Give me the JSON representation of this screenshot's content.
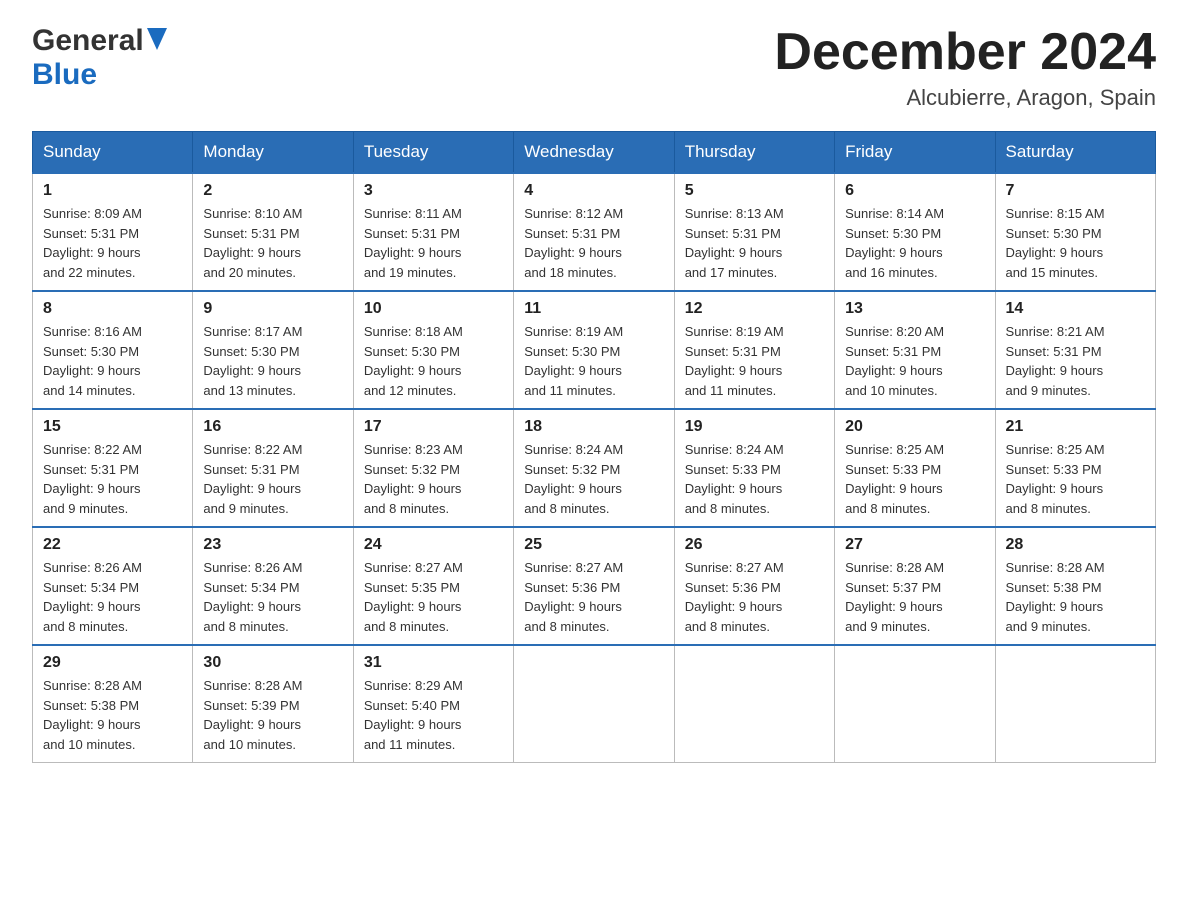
{
  "header": {
    "logo": {
      "general": "General",
      "blue": "Blue",
      "triangle_alt": "triangle"
    },
    "month_title": "December 2024",
    "location": "Alcubierre, Aragon, Spain"
  },
  "calendar": {
    "days_of_week": [
      "Sunday",
      "Monday",
      "Tuesday",
      "Wednesday",
      "Thursday",
      "Friday",
      "Saturday"
    ],
    "weeks": [
      [
        {
          "day": "1",
          "sunrise": "Sunrise: 8:09 AM",
          "sunset": "Sunset: 5:31 PM",
          "daylight": "Daylight: 9 hours and 22 minutes."
        },
        {
          "day": "2",
          "sunrise": "Sunrise: 8:10 AM",
          "sunset": "Sunset: 5:31 PM",
          "daylight": "Daylight: 9 hours and 20 minutes."
        },
        {
          "day": "3",
          "sunrise": "Sunrise: 8:11 AM",
          "sunset": "Sunset: 5:31 PM",
          "daylight": "Daylight: 9 hours and 19 minutes."
        },
        {
          "day": "4",
          "sunrise": "Sunrise: 8:12 AM",
          "sunset": "Sunset: 5:31 PM",
          "daylight": "Daylight: 9 hours and 18 minutes."
        },
        {
          "day": "5",
          "sunrise": "Sunrise: 8:13 AM",
          "sunset": "Sunset: 5:31 PM",
          "daylight": "Daylight: 9 hours and 17 minutes."
        },
        {
          "day": "6",
          "sunrise": "Sunrise: 8:14 AM",
          "sunset": "Sunset: 5:30 PM",
          "daylight": "Daylight: 9 hours and 16 minutes."
        },
        {
          "day": "7",
          "sunrise": "Sunrise: 8:15 AM",
          "sunset": "Sunset: 5:30 PM",
          "daylight": "Daylight: 9 hours and 15 minutes."
        }
      ],
      [
        {
          "day": "8",
          "sunrise": "Sunrise: 8:16 AM",
          "sunset": "Sunset: 5:30 PM",
          "daylight": "Daylight: 9 hours and 14 minutes."
        },
        {
          "day": "9",
          "sunrise": "Sunrise: 8:17 AM",
          "sunset": "Sunset: 5:30 PM",
          "daylight": "Daylight: 9 hours and 13 minutes."
        },
        {
          "day": "10",
          "sunrise": "Sunrise: 8:18 AM",
          "sunset": "Sunset: 5:30 PM",
          "daylight": "Daylight: 9 hours and 12 minutes."
        },
        {
          "day": "11",
          "sunrise": "Sunrise: 8:19 AM",
          "sunset": "Sunset: 5:30 PM",
          "daylight": "Daylight: 9 hours and 11 minutes."
        },
        {
          "day": "12",
          "sunrise": "Sunrise: 8:19 AM",
          "sunset": "Sunset: 5:31 PM",
          "daylight": "Daylight: 9 hours and 11 minutes."
        },
        {
          "day": "13",
          "sunrise": "Sunrise: 8:20 AM",
          "sunset": "Sunset: 5:31 PM",
          "daylight": "Daylight: 9 hours and 10 minutes."
        },
        {
          "day": "14",
          "sunrise": "Sunrise: 8:21 AM",
          "sunset": "Sunset: 5:31 PM",
          "daylight": "Daylight: 9 hours and 9 minutes."
        }
      ],
      [
        {
          "day": "15",
          "sunrise": "Sunrise: 8:22 AM",
          "sunset": "Sunset: 5:31 PM",
          "daylight": "Daylight: 9 hours and 9 minutes."
        },
        {
          "day": "16",
          "sunrise": "Sunrise: 8:22 AM",
          "sunset": "Sunset: 5:31 PM",
          "daylight": "Daylight: 9 hours and 9 minutes."
        },
        {
          "day": "17",
          "sunrise": "Sunrise: 8:23 AM",
          "sunset": "Sunset: 5:32 PM",
          "daylight": "Daylight: 9 hours and 8 minutes."
        },
        {
          "day": "18",
          "sunrise": "Sunrise: 8:24 AM",
          "sunset": "Sunset: 5:32 PM",
          "daylight": "Daylight: 9 hours and 8 minutes."
        },
        {
          "day": "19",
          "sunrise": "Sunrise: 8:24 AM",
          "sunset": "Sunset: 5:33 PM",
          "daylight": "Daylight: 9 hours and 8 minutes."
        },
        {
          "day": "20",
          "sunrise": "Sunrise: 8:25 AM",
          "sunset": "Sunset: 5:33 PM",
          "daylight": "Daylight: 9 hours and 8 minutes."
        },
        {
          "day": "21",
          "sunrise": "Sunrise: 8:25 AM",
          "sunset": "Sunset: 5:33 PM",
          "daylight": "Daylight: 9 hours and 8 minutes."
        }
      ],
      [
        {
          "day": "22",
          "sunrise": "Sunrise: 8:26 AM",
          "sunset": "Sunset: 5:34 PM",
          "daylight": "Daylight: 9 hours and 8 minutes."
        },
        {
          "day": "23",
          "sunrise": "Sunrise: 8:26 AM",
          "sunset": "Sunset: 5:34 PM",
          "daylight": "Daylight: 9 hours and 8 minutes."
        },
        {
          "day": "24",
          "sunrise": "Sunrise: 8:27 AM",
          "sunset": "Sunset: 5:35 PM",
          "daylight": "Daylight: 9 hours and 8 minutes."
        },
        {
          "day": "25",
          "sunrise": "Sunrise: 8:27 AM",
          "sunset": "Sunset: 5:36 PM",
          "daylight": "Daylight: 9 hours and 8 minutes."
        },
        {
          "day": "26",
          "sunrise": "Sunrise: 8:27 AM",
          "sunset": "Sunset: 5:36 PM",
          "daylight": "Daylight: 9 hours and 8 minutes."
        },
        {
          "day": "27",
          "sunrise": "Sunrise: 8:28 AM",
          "sunset": "Sunset: 5:37 PM",
          "daylight": "Daylight: 9 hours and 9 minutes."
        },
        {
          "day": "28",
          "sunrise": "Sunrise: 8:28 AM",
          "sunset": "Sunset: 5:38 PM",
          "daylight": "Daylight: 9 hours and 9 minutes."
        }
      ],
      [
        {
          "day": "29",
          "sunrise": "Sunrise: 8:28 AM",
          "sunset": "Sunset: 5:38 PM",
          "daylight": "Daylight: 9 hours and 10 minutes."
        },
        {
          "day": "30",
          "sunrise": "Sunrise: 8:28 AM",
          "sunset": "Sunset: 5:39 PM",
          "daylight": "Daylight: 9 hours and 10 minutes."
        },
        {
          "day": "31",
          "sunrise": "Sunrise: 8:29 AM",
          "sunset": "Sunset: 5:40 PM",
          "daylight": "Daylight: 9 hours and 11 minutes."
        },
        null,
        null,
        null,
        null
      ]
    ]
  }
}
